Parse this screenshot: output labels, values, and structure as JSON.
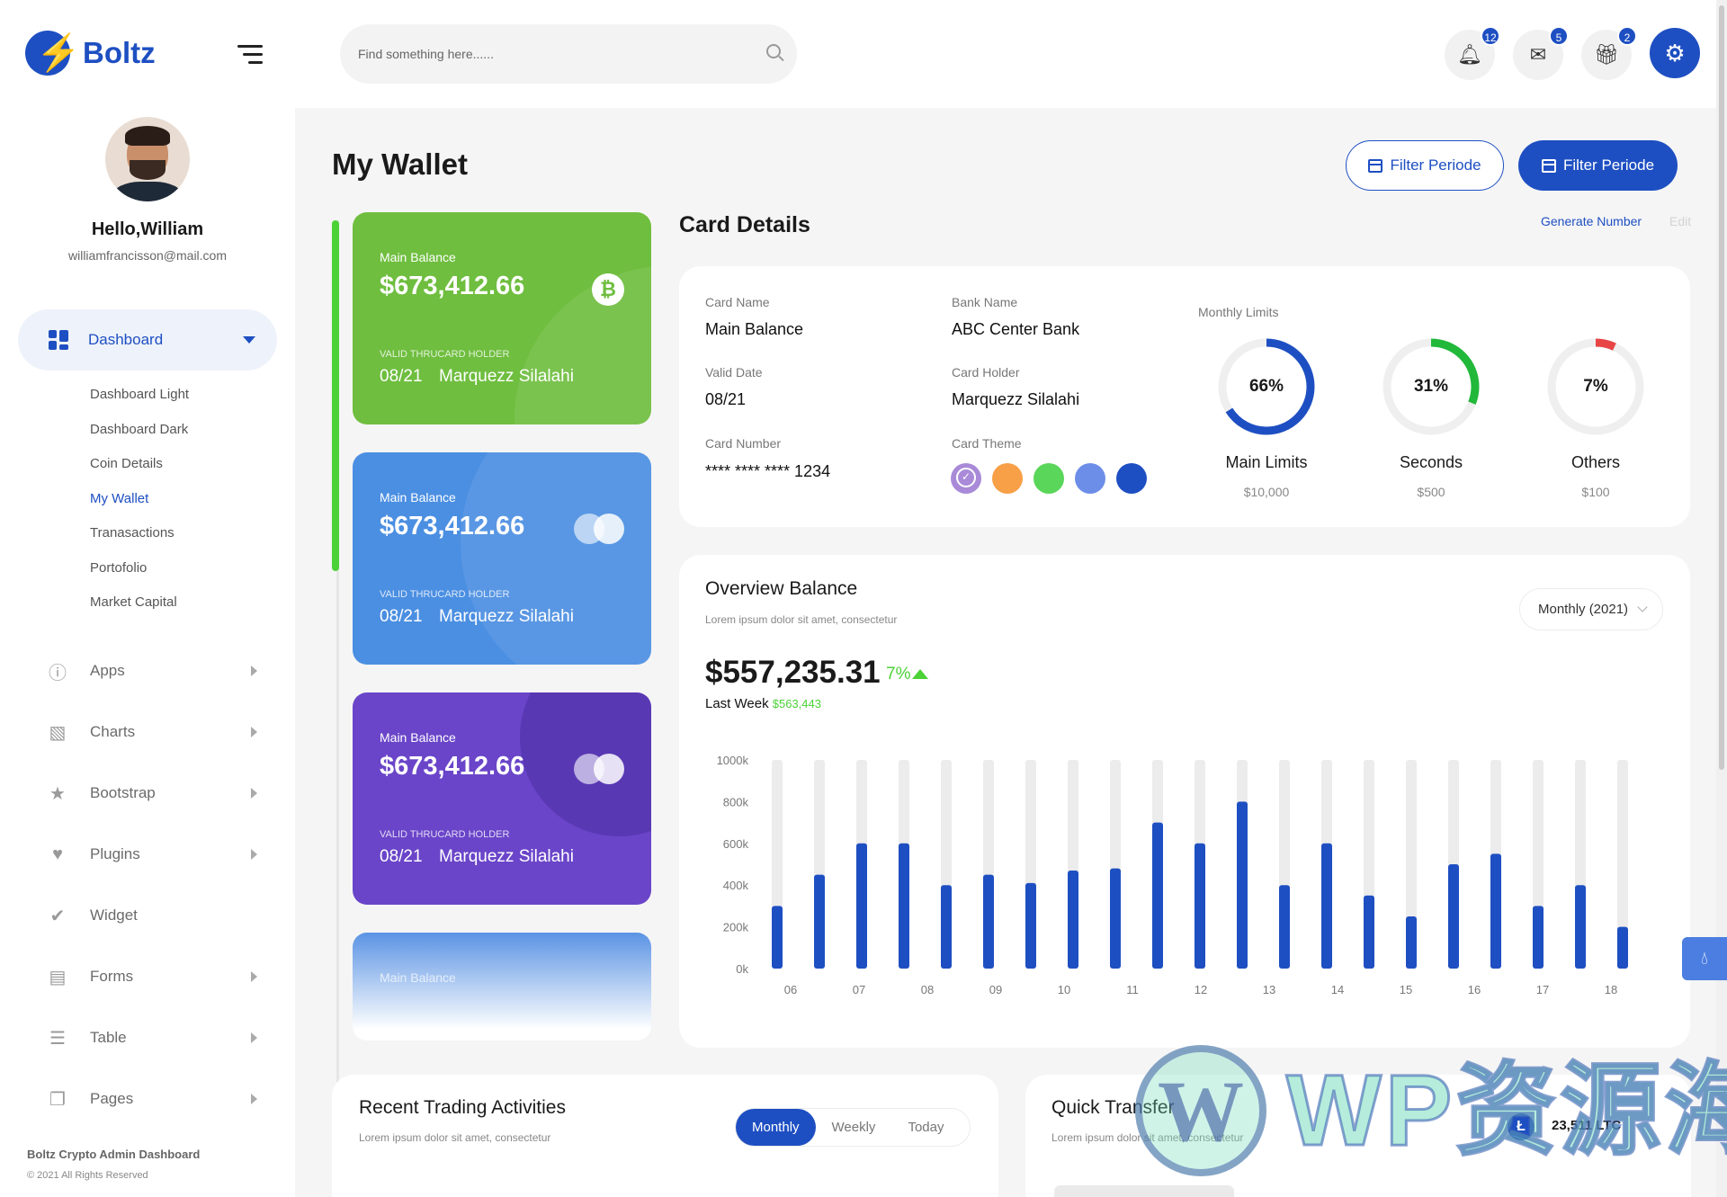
{
  "brand": {
    "name": "Boltz"
  },
  "user": {
    "greeting": "Hello,William",
    "email": "williamfrancisson@mail.com"
  },
  "sidebar": {
    "dashboard_label": "Dashboard",
    "subitems": [
      "Dashboard Light",
      "Dashboard Dark",
      "Coin Details",
      "My Wallet",
      "Tranasactions",
      "Portofolio",
      "Market Capital"
    ],
    "active_subitem": "My Wallet",
    "menu": [
      {
        "label": "Apps",
        "icon": "info-icon",
        "arrow": true
      },
      {
        "label": "Charts",
        "icon": "chart-icon",
        "arrow": true
      },
      {
        "label": "Bootstrap",
        "icon": "star-icon",
        "arrow": true
      },
      {
        "label": "Plugins",
        "icon": "heart-icon",
        "arrow": true
      },
      {
        "label": "Widget",
        "icon": "widget-icon",
        "arrow": false
      },
      {
        "label": "Forms",
        "icon": "printer-icon",
        "arrow": true
      },
      {
        "label": "Table",
        "icon": "table-icon",
        "arrow": true
      },
      {
        "label": "Pages",
        "icon": "pages-icon",
        "arrow": true
      }
    ],
    "footer_brand": "Boltz Crypto Admin Dashboard",
    "footer_copy": "© 2021 All Rights Reserved"
  },
  "topbar": {
    "search_placeholder": "Find something here......",
    "notifications_count": "12",
    "messages_count": "5",
    "gifts_count": "2"
  },
  "page": {
    "title": "My Wallet",
    "filter_outline_label": "Filter Periode",
    "filter_solid_label": "Filter Periode"
  },
  "cards": [
    {
      "label": "Main Balance",
      "balance": "$673,412.66",
      "holder_caption": "VALID THRUCARD HOLDER",
      "valid": "08/21",
      "name": "Marquezz Silalahi",
      "color": "#6fbe3f",
      "badge": "bitcoin"
    },
    {
      "label": "Main Balance",
      "balance": "$673,412.66",
      "holder_caption": "VALID THRUCARD HOLDER",
      "valid": "08/21",
      "name": "Marquezz Silalahi",
      "color": "#4b8fe2",
      "badge": "mastercard"
    },
    {
      "label": "Main Balance",
      "balance": "$673,412.66",
      "holder_caption": "VALID THRUCARD HOLDER",
      "valid": "08/21",
      "name": "Marquezz Silalahi",
      "color": "#6a45c9",
      "badge": "mastercard"
    },
    {
      "label": "Main Balance"
    }
  ],
  "card_details": {
    "title": "Card Details",
    "generate_label": "Generate Number",
    "edit_label": "Edit",
    "card_name_label": "Card Name",
    "card_name": "Main Balance",
    "bank_name_label": "Bank Name",
    "bank_name": "ABC Center Bank",
    "valid_date_label": "Valid Date",
    "valid_date": "08/21",
    "card_holder_label": "Card Holder",
    "card_holder": "Marquezz Silalahi",
    "card_number_label": "Card Number",
    "card_number": "**** **** **** 1234",
    "card_theme_label": "Card Theme",
    "themes": [
      "#a98ad8",
      "#f7a047",
      "#5ad65a",
      "#6c8ee8",
      "#1e4fc2"
    ],
    "monthly_limits_label": "Monthly Limits",
    "limits": [
      {
        "pct": "66%",
        "fraction": 0.66,
        "name": "Main Limits",
        "amount": "$10,000",
        "color": "#1e4fc2"
      },
      {
        "pct": "31%",
        "fraction": 0.31,
        "name": "Seconds",
        "amount": "$500",
        "color": "#22b83a"
      },
      {
        "pct": "7%",
        "fraction": 0.07,
        "name": "Others",
        "amount": "$100",
        "color": "#e84545"
      }
    ]
  },
  "overview": {
    "title": "Overview Balance",
    "subtitle": "Lorem ipsum dolor sit amet, consectetur",
    "period": "Monthly (2021)",
    "amount": "$557,235.31",
    "change": "7%",
    "last_week_label": "Last Week",
    "last_week_value": "$563,443"
  },
  "chart_data": {
    "type": "bar",
    "y_ticks": [
      "1000k",
      "800k",
      "600k",
      "400k",
      "200k",
      "0k"
    ],
    "ylim": [
      0,
      1000
    ],
    "x_ticks": [
      "06",
      "07",
      "08",
      "09",
      "10",
      "11",
      "12",
      "13",
      "14",
      "15",
      "16",
      "17",
      "18"
    ],
    "bar_color": "#1e4fc2",
    "track_color": "#ececec",
    "values": [
      300,
      450,
      600,
      600,
      400,
      450,
      410,
      470,
      480,
      700,
      600,
      800,
      400,
      600,
      350,
      250,
      500,
      550,
      300,
      400,
      200
    ]
  },
  "trading": {
    "title": "Recent Trading Activities",
    "subtitle": "Lorem ipsum dolor sit amet, consectetur",
    "tabs": [
      "Monthly",
      "Weekly",
      "Today"
    ],
    "active_tab": "Monthly"
  },
  "transfer": {
    "title": "Quick Transfer",
    "subtitle": "Lorem ipsum dolor sit amet, consectetur",
    "coin_icon": "litecoin-icon",
    "amount": "23,511 LTC"
  },
  "watermark": {
    "text": "WP资源海"
  }
}
